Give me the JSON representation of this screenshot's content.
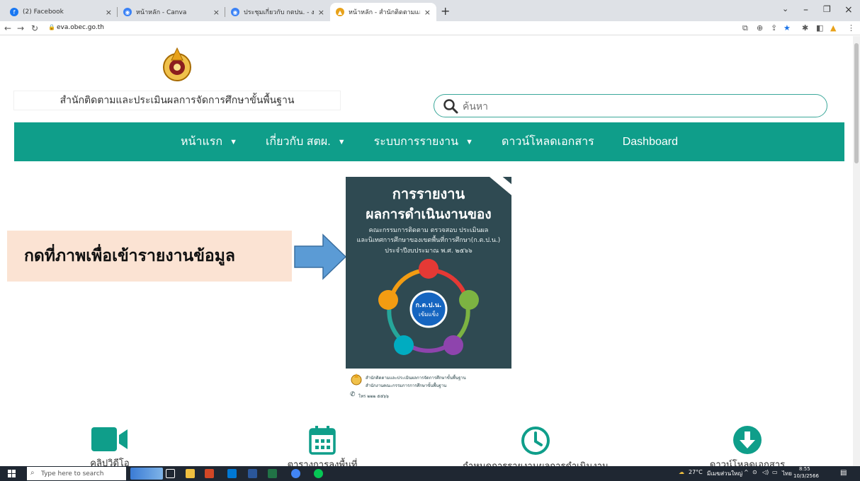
{
  "browser": {
    "tabs": [
      {
        "title": "(2) Facebook",
        "icon": "facebook-icon",
        "color": "#1877f2"
      },
      {
        "title": "หน้าหลัก - Canva",
        "icon": "canva-icon",
        "color": "#3b82f6"
      },
      {
        "title": "ประชุมเกี่ยวกับ กตปน. - งานนำเสนอ",
        "icon": "slides-icon",
        "color": "#3b82f6"
      },
      {
        "title": "หน้าหลัก - สำนักติดตามและประเมินผล",
        "icon": "obec-icon",
        "color": "#e8a21a"
      }
    ],
    "url": "eva.obec.go.th"
  },
  "site": {
    "name": "สำนักติดตามและประเมินผลการจัดการศึกษาขั้นพื้นฐาน",
    "search_placeholder": "ค้นหา"
  },
  "nav": {
    "items": [
      {
        "label": "หน้าแรก",
        "has_dropdown": true
      },
      {
        "label": "เกี่ยวกับ สตผ.",
        "has_dropdown": true
      },
      {
        "label": "ระบบการรายงาน",
        "has_dropdown": true
      },
      {
        "label": "ดาวน์โหลดเอกสาร",
        "has_dropdown": false
      },
      {
        "label": "Dashboard",
        "has_dropdown": false
      }
    ],
    "caret": "▼"
  },
  "callout": {
    "text": "กดที่ภาพเพื่อเข้ารายงานข้อมูล"
  },
  "poster": {
    "title1": "การรายงาน",
    "title2": "ผลการดำเนินงานของ",
    "line1": "คณะกรรมการติดตาม ตรวจสอบ ประเมินผล",
    "line2": "และนิเทศการศึกษาของเขตพื้นที่การศึกษา(ก.ต.ป.น.)",
    "line3": "ประจำปีงบประมาณ พ.ศ. ๒๕๖๖",
    "center_top": "ก.ต.ป.น.",
    "center_bottom": "เข้มแข็ง",
    "footer1": "สำนักติดตามและประเมินผลการจัดการศึกษาขั้นพื้นฐาน",
    "footer2": "สำนักงานคณะกรรมการการศึกษาขั้นพื้นฐาน",
    "footer3": "โทร ๒๒๒ ๕๕๖๖"
  },
  "features": [
    {
      "label": "คลิปวิดีโอ",
      "icon": "video-camera-icon"
    },
    {
      "label": "ตารางการลงพื้นที่",
      "icon": "calendar-icon"
    },
    {
      "label": "กำหนดการรายงานผลการดำเนินงาน",
      "icon": "clock-icon"
    },
    {
      "label": "ดาวน์โหลดเอกสาร",
      "icon": "download-icon"
    }
  ],
  "colors": {
    "accent": "#0f9e8a"
  },
  "taskbar": {
    "search_placeholder": "Type here to search",
    "weather": "27°C",
    "weather_desc": "มีเมฆส่วนใหญ่",
    "lang": "ไทย",
    "time": "8:55",
    "date": "10/3/2566"
  }
}
